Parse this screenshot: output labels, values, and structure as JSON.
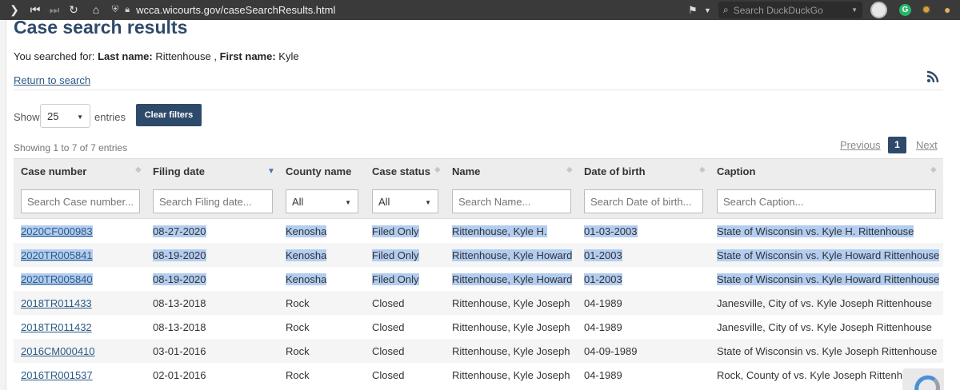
{
  "browser": {
    "url": "wcca.wicourts.gov/caseSearchResults.html",
    "search_placeholder": "Search DuckDuckGo",
    "ext_icon_letter": "G"
  },
  "page": {
    "title": "Case search results",
    "searched_prefix": "You searched for:",
    "last_name_label": "Last name:",
    "last_name_value": "Rittenhouse",
    "separator": ",",
    "first_name_label": "First name:",
    "first_name_value": "Kyle",
    "return_link": "Return to search"
  },
  "controls": {
    "show_label": "Show",
    "show_value": "25",
    "entries_label": "entries",
    "clear_filters": "Clear filters",
    "showing_text": "Showing 1 to 7 of 7 entries",
    "prev": "Previous",
    "current_page": "1",
    "next": "Next"
  },
  "table": {
    "headers": [
      "Case number",
      "Filing date",
      "County name",
      "Case status",
      "Name",
      "Date of birth",
      "Caption"
    ],
    "filters": {
      "case_number": "Search Case number...",
      "filing_date": "Search Filing date...",
      "county": "All",
      "status": "All",
      "name": "Search Name...",
      "dob": "Search Date of birth...",
      "caption": "Search Caption..."
    },
    "rows": [
      {
        "case": "2020CF000983",
        "filed": "08-27-2020",
        "county": "Kenosha",
        "status": "Filed Only",
        "name": "Rittenhouse, Kyle H.",
        "dob": "01-03-2003",
        "caption": "State of Wisconsin vs. Kyle H. Rittenhouse",
        "highlighted": true
      },
      {
        "case": "2020TR005841",
        "filed": "08-19-2020",
        "county": "Kenosha",
        "status": "Filed Only",
        "name": "Rittenhouse, Kyle Howard",
        "dob": "01-2003",
        "caption": "State of Wisconsin vs. Kyle Howard Rittenhouse",
        "highlighted": true
      },
      {
        "case": "2020TR005840",
        "filed": "08-19-2020",
        "county": "Kenosha",
        "status": "Filed Only",
        "name": "Rittenhouse, Kyle Howard",
        "dob": "01-2003",
        "caption": "State of Wisconsin vs. Kyle Howard Rittenhouse",
        "highlighted": true
      },
      {
        "case": "2018TR011433",
        "filed": "08-13-2018",
        "county": "Rock",
        "status": "Closed",
        "name": "Rittenhouse, Kyle Joseph",
        "dob": "04-1989",
        "caption": "Janesville, City of vs. Kyle Joseph Rittenhouse",
        "highlighted": false
      },
      {
        "case": "2018TR011432",
        "filed": "08-13-2018",
        "county": "Rock",
        "status": "Closed",
        "name": "Rittenhouse, Kyle Joseph",
        "dob": "04-1989",
        "caption": "Janesville, City of vs. Kyle Joseph Rittenhouse",
        "highlighted": false
      },
      {
        "case": "2016CM000410",
        "filed": "03-01-2016",
        "county": "Rock",
        "status": "Closed",
        "name": "Rittenhouse, Kyle Joseph",
        "dob": "04-09-1989",
        "caption": "State of Wisconsin vs. Kyle Joseph Rittenhouse",
        "highlighted": false
      },
      {
        "case": "2016TR001537",
        "filed": "02-01-2016",
        "county": "Rock",
        "status": "Closed",
        "name": "Rittenhouse, Kyle Joseph",
        "dob": "04-1989",
        "caption": "Rock, County of vs. Kyle Joseph Rittenhouse",
        "highlighted": false
      }
    ]
  },
  "colors": {
    "brand": "#2e4a6b",
    "link": "#2b5a86",
    "selection": "#b3cdf0",
    "sort_active": "#4a74b8"
  }
}
